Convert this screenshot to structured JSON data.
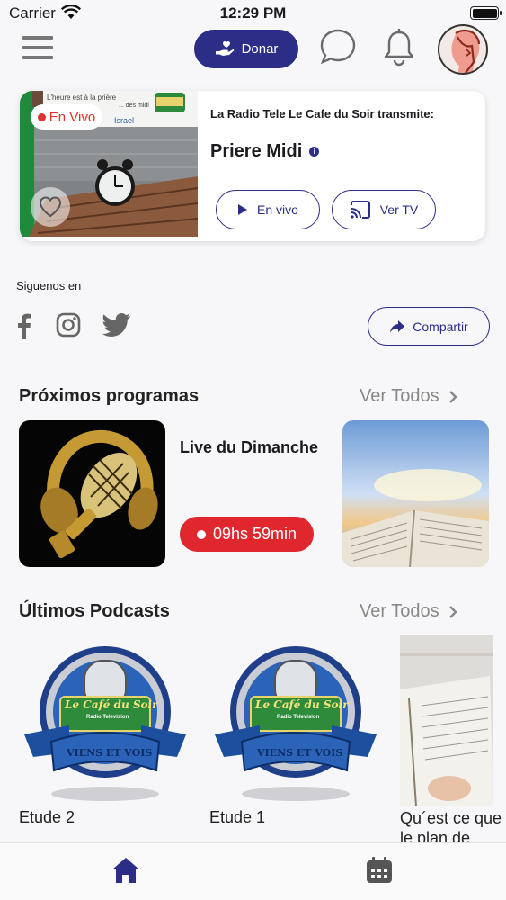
{
  "status_bar": {
    "carrier": "Carrier",
    "time": "12:29 PM"
  },
  "header": {
    "donate_label": "Donar"
  },
  "live": {
    "badge": "En Vivo",
    "thumb_text_1": "L'heure est à la prière",
    "thumb_text_2": "... des midi",
    "thumb_text_3": "Israel",
    "station": "La Radio Tele Le Cafe du Soir transmite:",
    "program": "Priere Midi",
    "en_vivo_button": "En vivo",
    "ver_tv_button": "Ver TV"
  },
  "social": {
    "label": "Siguenos en",
    "share_label": "Compartir"
  },
  "upcoming": {
    "title": "Próximos programas",
    "see_all": "Ver Todos",
    "items": [
      {
        "name": "Live du Dimanche",
        "countdown": "09hs 59min"
      }
    ]
  },
  "podcasts": {
    "title": "Últimos Podcasts",
    "see_all": "Ver Todos",
    "logo_text_1": "Le Café du Soir",
    "logo_text_2": "Radio Television",
    "logo_banner": "VIENS ET VOIS",
    "items": [
      {
        "name": "Etude 2"
      },
      {
        "name": "Etude 1"
      },
      {
        "name": "Qu´est ce que le plan de Dieu"
      }
    ]
  },
  "colors": {
    "primary": "#2b2d86",
    "live_red": "#e0272e",
    "muted": "#888888"
  },
  "icons": [
    "menu-icon",
    "donate-hand-heart-icon",
    "chat-bubble-icon",
    "bell-icon",
    "avatar",
    "heart-icon",
    "play-icon",
    "cast-icon",
    "facebook-icon",
    "instagram-icon",
    "twitter-icon",
    "share-icon",
    "chevron-right-icon",
    "home-icon",
    "calendar-icon"
  ]
}
